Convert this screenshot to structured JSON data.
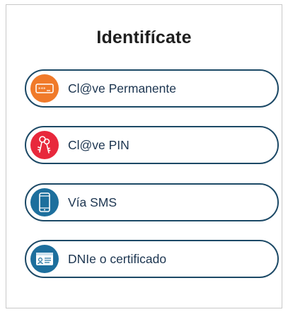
{
  "title": "Identifícate",
  "options": [
    {
      "label": "Cl@ve Permanente",
      "icon": "password-field-icon",
      "color": "#f07a2a"
    },
    {
      "label": "Cl@ve PIN",
      "icon": "keys-icon",
      "color": "#e8283c"
    },
    {
      "label": "Vía SMS",
      "icon": "mobile-phone-icon",
      "color": "#1d6f9d"
    },
    {
      "label": "DNIe o certificado",
      "icon": "id-card-icon",
      "color": "#1d6f9d"
    }
  ]
}
